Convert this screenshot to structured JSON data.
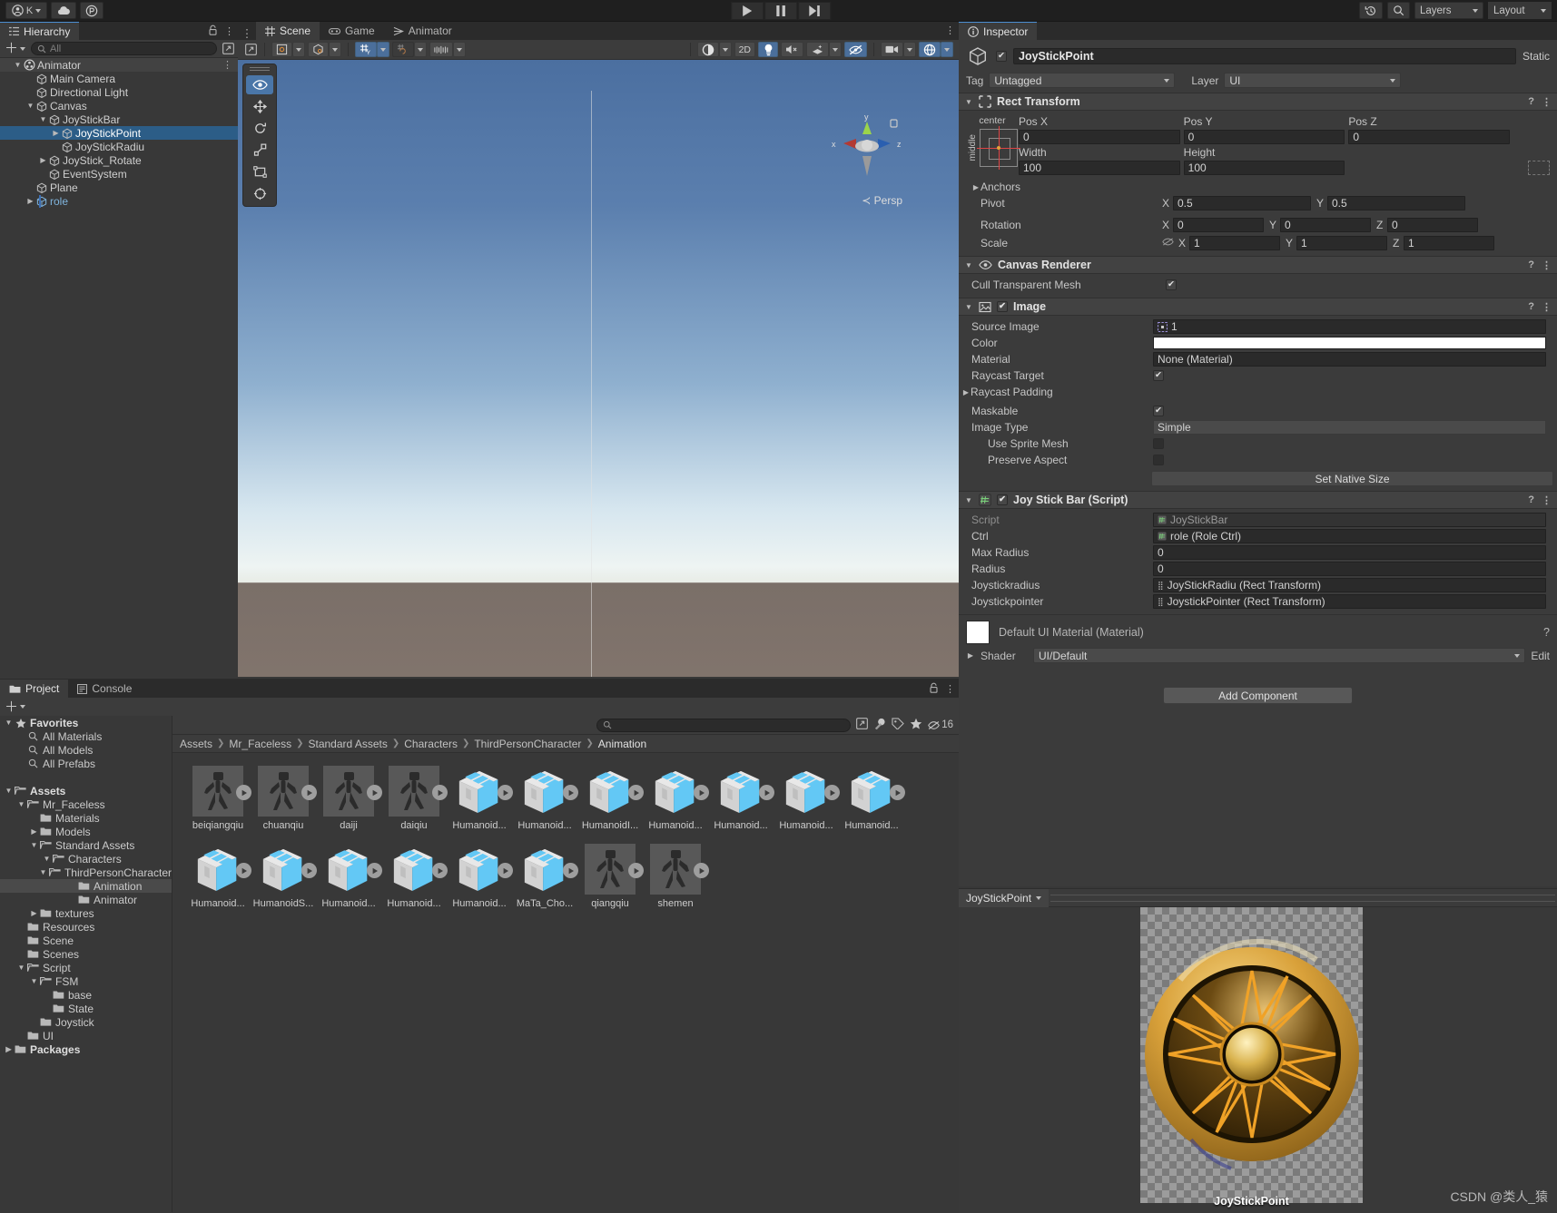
{
  "topbar": {
    "account_label": "K",
    "icons": [
      "account-icon",
      "cloud-icon",
      "collab-icon"
    ],
    "play": "▶",
    "pause": "❙❙",
    "step": "▶❙",
    "history_icon": "undo-history-icon",
    "search_icon": "search-icon",
    "layers_label": "Layers",
    "layout_label": "Layout"
  },
  "hierarchy": {
    "tab": "Hierarchy",
    "search_placeholder": "All",
    "items": [
      {
        "label": "Animator",
        "depth": 0,
        "tri": "down",
        "icon": "scene-icon",
        "selected": false,
        "header": true
      },
      {
        "label": "Main Camera",
        "depth": 1,
        "tri": "none",
        "icon": "gameobject-icon",
        "selected": false
      },
      {
        "label": "Directional Light",
        "depth": 1,
        "tri": "none",
        "icon": "gameobject-icon",
        "selected": false
      },
      {
        "label": "Canvas",
        "depth": 1,
        "tri": "down",
        "icon": "gameobject-icon",
        "selected": false
      },
      {
        "label": "JoyStickBar",
        "depth": 2,
        "tri": "down",
        "icon": "gameobject-icon",
        "selected": false
      },
      {
        "label": "JoyStickPoint",
        "depth": 3,
        "tri": "right",
        "icon": "gameobject-icon",
        "selected": true
      },
      {
        "label": "JoyStickRadiu",
        "depth": 3,
        "tri": "none",
        "icon": "gameobject-icon",
        "selected": false
      },
      {
        "label": "JoyStick_Rotate",
        "depth": 2,
        "tri": "right",
        "icon": "gameobject-icon",
        "selected": false
      },
      {
        "label": "EventSystem",
        "depth": 2,
        "tri": "none",
        "icon": "gameobject-icon",
        "selected": false
      },
      {
        "label": "Plane",
        "depth": 1,
        "tri": "none",
        "icon": "gameobject-icon",
        "selected": false
      },
      {
        "label": "role",
        "depth": 1,
        "tri": "right",
        "icon": "prefab-icon",
        "selected": false,
        "prefab": true
      }
    ]
  },
  "sceneview": {
    "tabs": [
      {
        "label": "Scene",
        "icon": "grid-icon",
        "active": true
      },
      {
        "label": "Game",
        "icon": "gamepad-icon",
        "active": false
      },
      {
        "label": "Animator",
        "icon": "animator-icon",
        "active": false
      }
    ],
    "toolbar": {
      "pivot_label": "pivot-mode-icon",
      "handle_label": "handle-space-icon",
      "grid_icon": "grid-snap-icon",
      "snap_icon": "snap-increment-icon",
      "scale_icon": "scene-scale-icon",
      "shading_icon": "shading-mode-icon",
      "twod_label": "2D",
      "light_icon": "scene-lighting-icon",
      "audio_icon": "scene-audio-icon",
      "fx_icon": "scene-fx-icon",
      "hidden_icon": "scene-visibility-icon",
      "camera_icon": "scene-camera-icon",
      "gizmos_icon": "gizmos-icon"
    },
    "tools": [
      {
        "name": "view-tool",
        "glyph": "✋",
        "active": true
      },
      {
        "name": "move-tool",
        "glyph": "✥",
        "active": false
      },
      {
        "name": "rotate-tool",
        "glyph": "⟳",
        "active": false
      },
      {
        "name": "scale-tool",
        "glyph": "⤢",
        "active": false
      },
      {
        "name": "rect-tool",
        "glyph": "▣",
        "active": false
      },
      {
        "name": "transform-tool",
        "glyph": "✦",
        "active": false
      }
    ],
    "axis_labels": {
      "x": "x",
      "y": "y",
      "z": "z"
    },
    "persp_label": "Persp"
  },
  "inspector": {
    "tab": "Inspector",
    "object": {
      "name": "JoyStickPoint",
      "enabled": true,
      "static_label": "Static",
      "tag_label": "Tag",
      "tag_value": "Untagged",
      "layer_label": "Layer",
      "layer_value": "UI"
    },
    "rect_transform": {
      "title": "Rect Transform",
      "anchor_preset_top": "center",
      "anchor_preset_side": "middle",
      "posx_label": "Pos X",
      "posx": "0",
      "posy_label": "Pos Y",
      "posy": "0",
      "posz_label": "Pos Z",
      "posz": "0",
      "width_label": "Width",
      "width": "100",
      "height_label": "Height",
      "height": "100",
      "anchors_label": "Anchors",
      "pivot_label": "Pivot",
      "pivot_x": "0.5",
      "pivot_y": "0.5",
      "rotation_label": "Rotation",
      "rot_x": "0",
      "rot_y": "0",
      "rot_z": "0",
      "scale_label": "Scale",
      "scale_x": "1",
      "scale_y": "1",
      "scale_z": "1"
    },
    "canvas_renderer": {
      "title": "Canvas Renderer",
      "cull_label": "Cull Transparent Mesh",
      "cull_checked": true
    },
    "image": {
      "title": "Image",
      "enabled": true,
      "source_label": "Source Image",
      "source_value": "1",
      "color_label": "Color",
      "color_value": "#FFFFFF",
      "material_label": "Material",
      "material_value": "None (Material)",
      "raycast_label": "Raycast Target",
      "raycast_checked": true,
      "padding_label": "Raycast Padding",
      "maskable_label": "Maskable",
      "maskable_checked": true,
      "type_label": "Image Type",
      "type_value": "Simple",
      "sprite_mesh_label": "Use Sprite Mesh",
      "sprite_mesh_checked": false,
      "preserve_label": "Preserve Aspect",
      "preserve_checked": false,
      "native_size_label": "Set Native Size"
    },
    "script_component": {
      "title": "Joy Stick Bar (Script)",
      "enabled": true,
      "script_label": "Script",
      "script_value": "JoyStickBar",
      "ctrl_label": "Ctrl",
      "ctrl_value": "role (Role Ctrl)",
      "max_radius_label": "Max Radius",
      "max_radius_value": "0",
      "radius_label": "Radius",
      "radius_value": "0",
      "joystickradius_label": "Joystickradius",
      "joystickradius_value": "JoyStickRadiu (Rect Transform)",
      "joystickpointer_label": "Joystickpointer",
      "joystickpointer_value": "JoystickPointer (Rect Transform)"
    },
    "material": {
      "title": "Default UI Material (Material)",
      "shader_label": "Shader",
      "shader_value": "UI/Default",
      "edit_label": "Edit"
    },
    "add_component_label": "Add Component"
  },
  "preview": {
    "name": "JoyStickPoint",
    "asset_label": "JoyStickPoint"
  },
  "project": {
    "tabs": [
      {
        "label": "Project",
        "icon": "folder-icon",
        "active": true
      },
      {
        "label": "Console",
        "icon": "console-icon",
        "active": false
      }
    ],
    "search_placeholder": "",
    "count_badge": "16",
    "breadcrumb": [
      "Assets",
      "Mr_Faceless",
      "Standard Assets",
      "Characters",
      "ThirdPersonCharacter",
      "Animation"
    ],
    "tree": [
      {
        "label": "Favorites",
        "depth": 0,
        "tri": "down",
        "icon": "star-icon",
        "bold": true
      },
      {
        "label": "All Materials",
        "depth": 1,
        "tri": "none",
        "icon": "search-icon"
      },
      {
        "label": "All Models",
        "depth": 1,
        "tri": "none",
        "icon": "search-icon"
      },
      {
        "label": "All Prefabs",
        "depth": 1,
        "tri": "none",
        "icon": "search-icon"
      },
      {
        "label": "",
        "depth": 0,
        "tri": "none",
        "icon": "spacer"
      },
      {
        "label": "Assets",
        "depth": 0,
        "tri": "down",
        "icon": "folder-open-icon",
        "bold": true
      },
      {
        "label": "Mr_Faceless",
        "depth": 1,
        "tri": "down",
        "icon": "folder-open-icon"
      },
      {
        "label": "Materials",
        "depth": 2,
        "tri": "none",
        "icon": "folder-icon"
      },
      {
        "label": "Models",
        "depth": 2,
        "tri": "right",
        "icon": "folder-icon"
      },
      {
        "label": "Standard Assets",
        "depth": 2,
        "tri": "down",
        "icon": "folder-open-icon"
      },
      {
        "label": "Characters",
        "depth": 3,
        "tri": "down",
        "icon": "folder-open-icon"
      },
      {
        "label": "ThirdPersonCharacter",
        "depth": 4,
        "tri": "down",
        "icon": "folder-open-icon"
      },
      {
        "label": "Animation",
        "depth": 5,
        "tri": "none",
        "icon": "folder-icon",
        "selected": true
      },
      {
        "label": "Animator",
        "depth": 5,
        "tri": "none",
        "icon": "folder-icon"
      },
      {
        "label": "textures",
        "depth": 2,
        "tri": "right",
        "icon": "folder-icon"
      },
      {
        "label": "Resources",
        "depth": 1,
        "tri": "none",
        "icon": "folder-icon"
      },
      {
        "label": "Scene",
        "depth": 1,
        "tri": "none",
        "icon": "folder-icon"
      },
      {
        "label": "Scenes",
        "depth": 1,
        "tri": "none",
        "icon": "folder-icon"
      },
      {
        "label": "Script",
        "depth": 1,
        "tri": "down",
        "icon": "folder-open-icon"
      },
      {
        "label": "FSM",
        "depth": 2,
        "tri": "down",
        "icon": "folder-open-icon"
      },
      {
        "label": "base",
        "depth": 3,
        "tri": "none",
        "icon": "folder-icon"
      },
      {
        "label": "State",
        "depth": 3,
        "tri": "none",
        "icon": "folder-icon"
      },
      {
        "label": "Joystick",
        "depth": 2,
        "tri": "none",
        "icon": "folder-icon"
      },
      {
        "label": "UI",
        "depth": 1,
        "tri": "none",
        "icon": "folder-icon"
      },
      {
        "label": "Packages",
        "depth": 0,
        "tri": "right",
        "icon": "folder-icon",
        "bold": true
      }
    ],
    "assets": [
      {
        "label": "beiqiangqiu",
        "kind": "animation-clip"
      },
      {
        "label": "chuanqiu",
        "kind": "animation-clip"
      },
      {
        "label": "daiji",
        "kind": "animation-clip"
      },
      {
        "label": "daiqiu",
        "kind": "animation-clip"
      },
      {
        "label": "Humanoid...",
        "kind": "model"
      },
      {
        "label": "Humanoid...",
        "kind": "model"
      },
      {
        "label": "HumanoidI...",
        "kind": "model"
      },
      {
        "label": "Humanoid...",
        "kind": "model"
      },
      {
        "label": "Humanoid...",
        "kind": "model"
      },
      {
        "label": "Humanoid...",
        "kind": "model"
      },
      {
        "label": "Humanoid...",
        "kind": "model"
      },
      {
        "label": "Humanoid...",
        "kind": "model"
      },
      {
        "label": "HumanoidS...",
        "kind": "model"
      },
      {
        "label": "Humanoid...",
        "kind": "model"
      },
      {
        "label": "Humanoid...",
        "kind": "model"
      },
      {
        "label": "Humanoid...",
        "kind": "model"
      },
      {
        "label": "MaTa_Cho...",
        "kind": "model"
      },
      {
        "label": "qiangqiu",
        "kind": "animation-clip"
      },
      {
        "label": "shemen",
        "kind": "animation-clip"
      }
    ]
  },
  "watermark": "CSDN @类人_猿"
}
